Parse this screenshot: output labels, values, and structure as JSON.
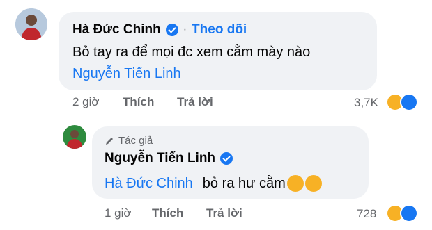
{
  "comment1": {
    "author": "Hà Đức Chinh",
    "follow": "Theo dõi",
    "text": "Bỏ tay ra để mọi đc xem cằm mày nào",
    "mention": "Nguyễn Tiến Linh",
    "time": "2 giờ",
    "like": "Thích",
    "reply": "Trả lời",
    "reactions": "3,7K"
  },
  "reply1": {
    "badge": "Tác giả",
    "author": "Nguyễn Tiến Linh",
    "mention": "Hà Đức Chinh",
    "text": "bỏ ra hư cằm",
    "time": "1 giờ",
    "like": "Thích",
    "reply": "Trả lời",
    "reactions": "728"
  },
  "colors": {
    "accent": "#1877f2",
    "bubble": "#f0f2f5",
    "meta": "#65676b"
  },
  "icons": [
    "verified-icon",
    "pencil-icon",
    "haha-emoji-icon",
    "like-icon",
    "rofl-emoji-icon"
  ]
}
